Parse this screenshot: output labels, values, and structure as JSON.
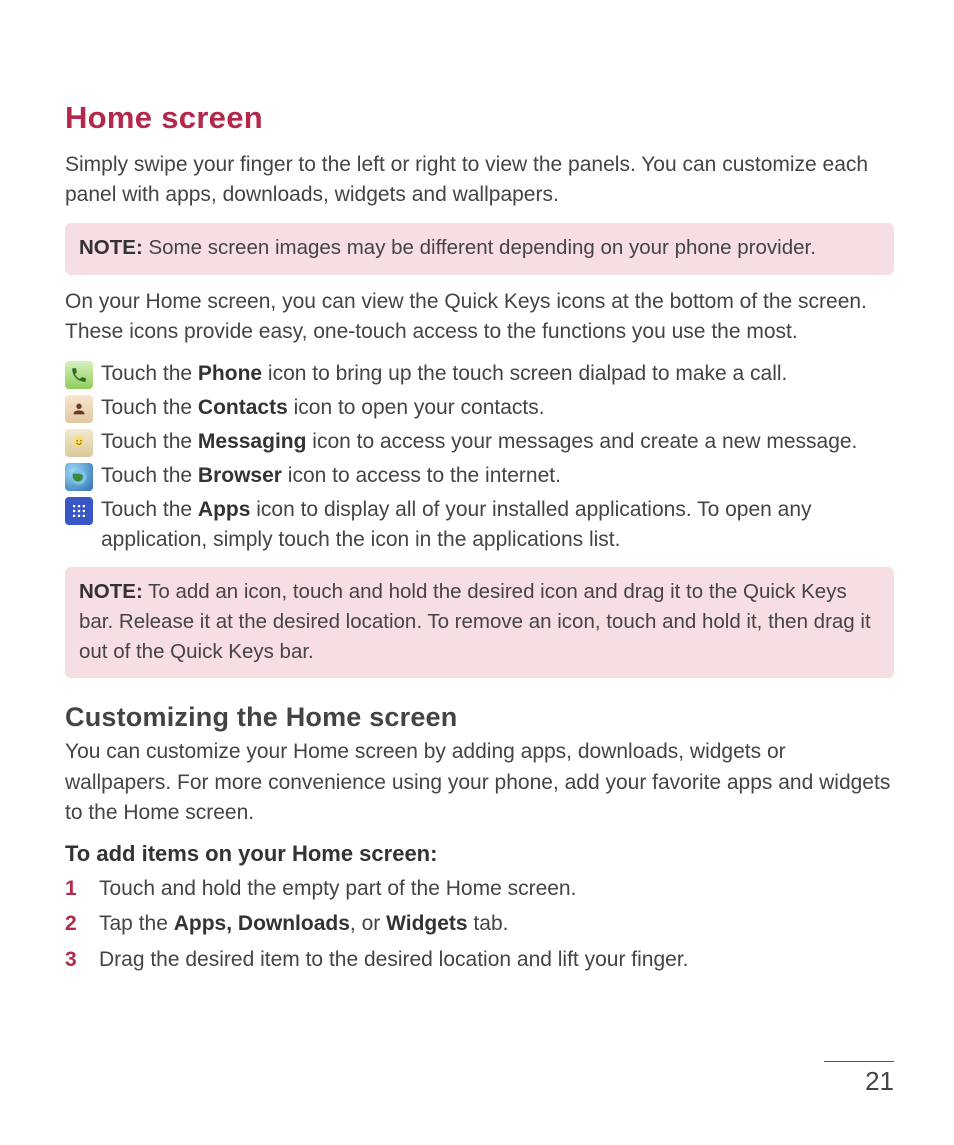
{
  "title": "Home screen",
  "intro": "Simply swipe your finger to the left or right to view the panels. You can customize each panel with apps, downloads, widgets and wallpapers.",
  "note1_label": "NOTE:",
  "note1_text": " Some screen images may be different depending on your phone provider.",
  "quickkeys_intro": "On your Home screen, you can view the Quick Keys icons at the bottom of the screen. These icons provide easy, one-touch access to the functions you use the most.",
  "icons": {
    "phone_pre": "Touch the ",
    "phone_bold": "Phone",
    "phone_post": " icon to bring up the touch screen dialpad to make a call.",
    "contacts_pre": "Touch the ",
    "contacts_bold": "Contacts",
    "contacts_post": " icon to open your contacts.",
    "messaging_pre": "Touch the ",
    "messaging_bold": "Messaging",
    "messaging_post": " icon to access your messages and create a new message.",
    "browser_pre": "Touch the ",
    "browser_bold": "Browser",
    "browser_post": " icon to access to the internet.",
    "apps_pre": "Touch the ",
    "apps_bold": "Apps",
    "apps_post": " icon to display all of your installed applications. To open any application, simply touch the icon in the applications list."
  },
  "note2_label": "NOTE:",
  "note2_text": " To add an icon, touch and hold the desired icon and drag it to the Quick Keys bar. Release it at the desired location. To remove an icon, touch and hold it, then drag it out of the Quick Keys bar.",
  "customize_heading": "Customizing the Home screen",
  "customize_body": "You can customize your Home screen by adding apps, downloads, widgets or wallpapers. For more convenience using your phone, add your favorite apps and widgets to the Home screen.",
  "add_heading": "To add items on your Home screen:",
  "steps": {
    "s1_num": "1",
    "s1_text": "Touch and hold the empty part of the Home screen.",
    "s2_num": "2",
    "s2_pre": "Tap the ",
    "s2_b1": "Apps, Downloads",
    "s2_mid": ", or ",
    "s2_b2": "Widgets",
    "s2_post": " tab.",
    "s3_num": "3",
    "s3_text": "Drag the desired item to the desired location and lift your finger."
  },
  "page_number": "21"
}
